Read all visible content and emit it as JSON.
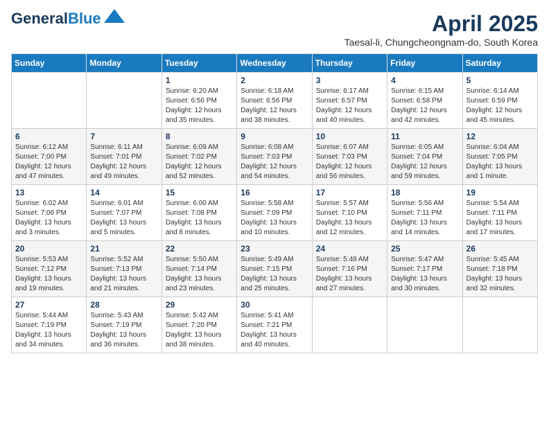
{
  "header": {
    "logo_line1": "General",
    "logo_line2": "Blue",
    "month_title": "April 2025",
    "subtitle": "Taesal-li, Chungcheongnam-do, South Korea"
  },
  "weekdays": [
    "Sunday",
    "Monday",
    "Tuesday",
    "Wednesday",
    "Thursday",
    "Friday",
    "Saturday"
  ],
  "weeks": [
    [
      {
        "day": "",
        "info": ""
      },
      {
        "day": "",
        "info": ""
      },
      {
        "day": "1",
        "info": "Sunrise: 6:20 AM\nSunset: 6:56 PM\nDaylight: 12 hours\nand 35 minutes."
      },
      {
        "day": "2",
        "info": "Sunrise: 6:18 AM\nSunset: 6:56 PM\nDaylight: 12 hours\nand 38 minutes."
      },
      {
        "day": "3",
        "info": "Sunrise: 6:17 AM\nSunset: 6:57 PM\nDaylight: 12 hours\nand 40 minutes."
      },
      {
        "day": "4",
        "info": "Sunrise: 6:15 AM\nSunset: 6:58 PM\nDaylight: 12 hours\nand 42 minutes."
      },
      {
        "day": "5",
        "info": "Sunrise: 6:14 AM\nSunset: 6:59 PM\nDaylight: 12 hours\nand 45 minutes."
      }
    ],
    [
      {
        "day": "6",
        "info": "Sunrise: 6:12 AM\nSunset: 7:00 PM\nDaylight: 12 hours\nand 47 minutes."
      },
      {
        "day": "7",
        "info": "Sunrise: 6:11 AM\nSunset: 7:01 PM\nDaylight: 12 hours\nand 49 minutes."
      },
      {
        "day": "8",
        "info": "Sunrise: 6:09 AM\nSunset: 7:02 PM\nDaylight: 12 hours\nand 52 minutes."
      },
      {
        "day": "9",
        "info": "Sunrise: 6:08 AM\nSunset: 7:03 PM\nDaylight: 12 hours\nand 54 minutes."
      },
      {
        "day": "10",
        "info": "Sunrise: 6:07 AM\nSunset: 7:03 PM\nDaylight: 12 hours\nand 56 minutes."
      },
      {
        "day": "11",
        "info": "Sunrise: 6:05 AM\nSunset: 7:04 PM\nDaylight: 12 hours\nand 59 minutes."
      },
      {
        "day": "12",
        "info": "Sunrise: 6:04 AM\nSunset: 7:05 PM\nDaylight: 13 hours\nand 1 minute."
      }
    ],
    [
      {
        "day": "13",
        "info": "Sunrise: 6:02 AM\nSunset: 7:06 PM\nDaylight: 13 hours\nand 3 minutes."
      },
      {
        "day": "14",
        "info": "Sunrise: 6:01 AM\nSunset: 7:07 PM\nDaylight: 13 hours\nand 5 minutes."
      },
      {
        "day": "15",
        "info": "Sunrise: 6:00 AM\nSunset: 7:08 PM\nDaylight: 13 hours\nand 8 minutes."
      },
      {
        "day": "16",
        "info": "Sunrise: 5:58 AM\nSunset: 7:09 PM\nDaylight: 13 hours\nand 10 minutes."
      },
      {
        "day": "17",
        "info": "Sunrise: 5:57 AM\nSunset: 7:10 PM\nDaylight: 13 hours\nand 12 minutes."
      },
      {
        "day": "18",
        "info": "Sunrise: 5:56 AM\nSunset: 7:11 PM\nDaylight: 13 hours\nand 14 minutes."
      },
      {
        "day": "19",
        "info": "Sunrise: 5:54 AM\nSunset: 7:11 PM\nDaylight: 13 hours\nand 17 minutes."
      }
    ],
    [
      {
        "day": "20",
        "info": "Sunrise: 5:53 AM\nSunset: 7:12 PM\nDaylight: 13 hours\nand 19 minutes."
      },
      {
        "day": "21",
        "info": "Sunrise: 5:52 AM\nSunset: 7:13 PM\nDaylight: 13 hours\nand 21 minutes."
      },
      {
        "day": "22",
        "info": "Sunrise: 5:50 AM\nSunset: 7:14 PM\nDaylight: 13 hours\nand 23 minutes."
      },
      {
        "day": "23",
        "info": "Sunrise: 5:49 AM\nSunset: 7:15 PM\nDaylight: 13 hours\nand 25 minutes."
      },
      {
        "day": "24",
        "info": "Sunrise: 5:48 AM\nSunset: 7:16 PM\nDaylight: 13 hours\nand 27 minutes."
      },
      {
        "day": "25",
        "info": "Sunrise: 5:47 AM\nSunset: 7:17 PM\nDaylight: 13 hours\nand 30 minutes."
      },
      {
        "day": "26",
        "info": "Sunrise: 5:45 AM\nSunset: 7:18 PM\nDaylight: 13 hours\nand 32 minutes."
      }
    ],
    [
      {
        "day": "27",
        "info": "Sunrise: 5:44 AM\nSunset: 7:19 PM\nDaylight: 13 hours\nand 34 minutes."
      },
      {
        "day": "28",
        "info": "Sunrise: 5:43 AM\nSunset: 7:19 PM\nDaylight: 13 hours\nand 36 minutes."
      },
      {
        "day": "29",
        "info": "Sunrise: 5:42 AM\nSunset: 7:20 PM\nDaylight: 13 hours\nand 38 minutes."
      },
      {
        "day": "30",
        "info": "Sunrise: 5:41 AM\nSunset: 7:21 PM\nDaylight: 13 hours\nand 40 minutes."
      },
      {
        "day": "",
        "info": ""
      },
      {
        "day": "",
        "info": ""
      },
      {
        "day": "",
        "info": ""
      }
    ]
  ]
}
